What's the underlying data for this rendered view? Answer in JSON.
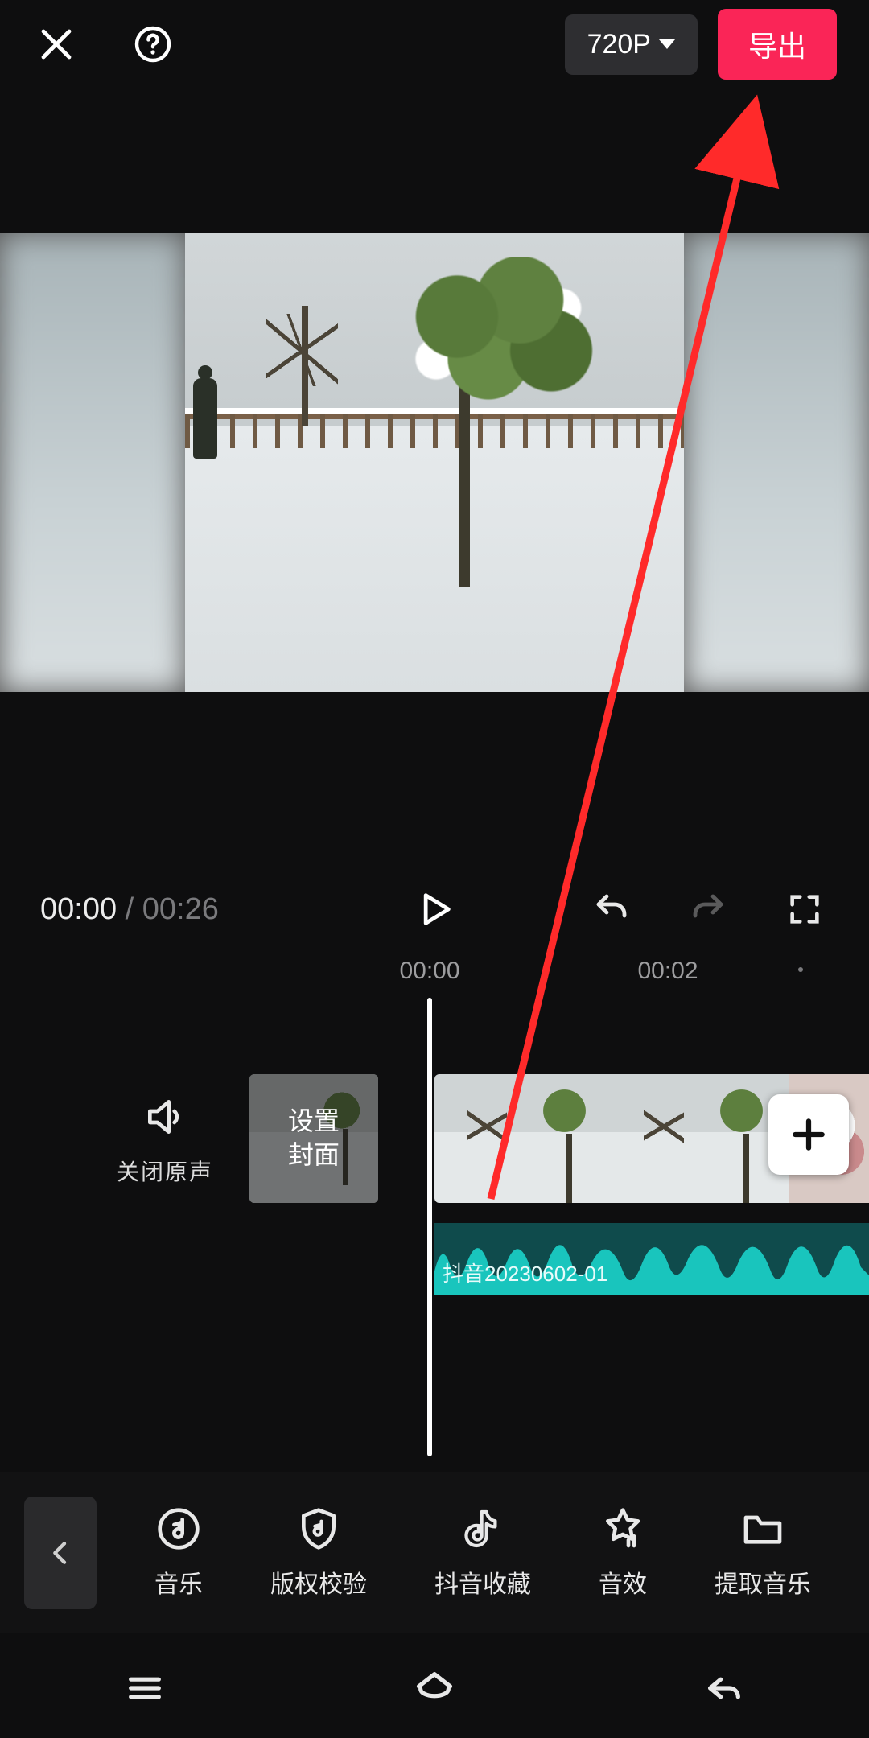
{
  "header": {
    "resolution_label": "720P",
    "export_label": "导出"
  },
  "player": {
    "current_time": "00:00",
    "separator": " / ",
    "duration": "00:26"
  },
  "ruler": {
    "tick_0": "00:00",
    "tick_1": "00:02"
  },
  "tracks": {
    "mute_label": "关闭原声",
    "cover_label": "设置\n封面",
    "audio_clip_name": "抖音20230602-01"
  },
  "toolbar": {
    "items": [
      {
        "id": "music",
        "label": "音乐"
      },
      {
        "id": "copyright",
        "label": "版权校验"
      },
      {
        "id": "douyin",
        "label": "抖音收藏"
      },
      {
        "id": "sfx",
        "label": "音效"
      },
      {
        "id": "extract",
        "label": "提取音乐"
      }
    ]
  },
  "colors": {
    "accent": "#fa2557",
    "audio_wave": "#19c5bd"
  }
}
